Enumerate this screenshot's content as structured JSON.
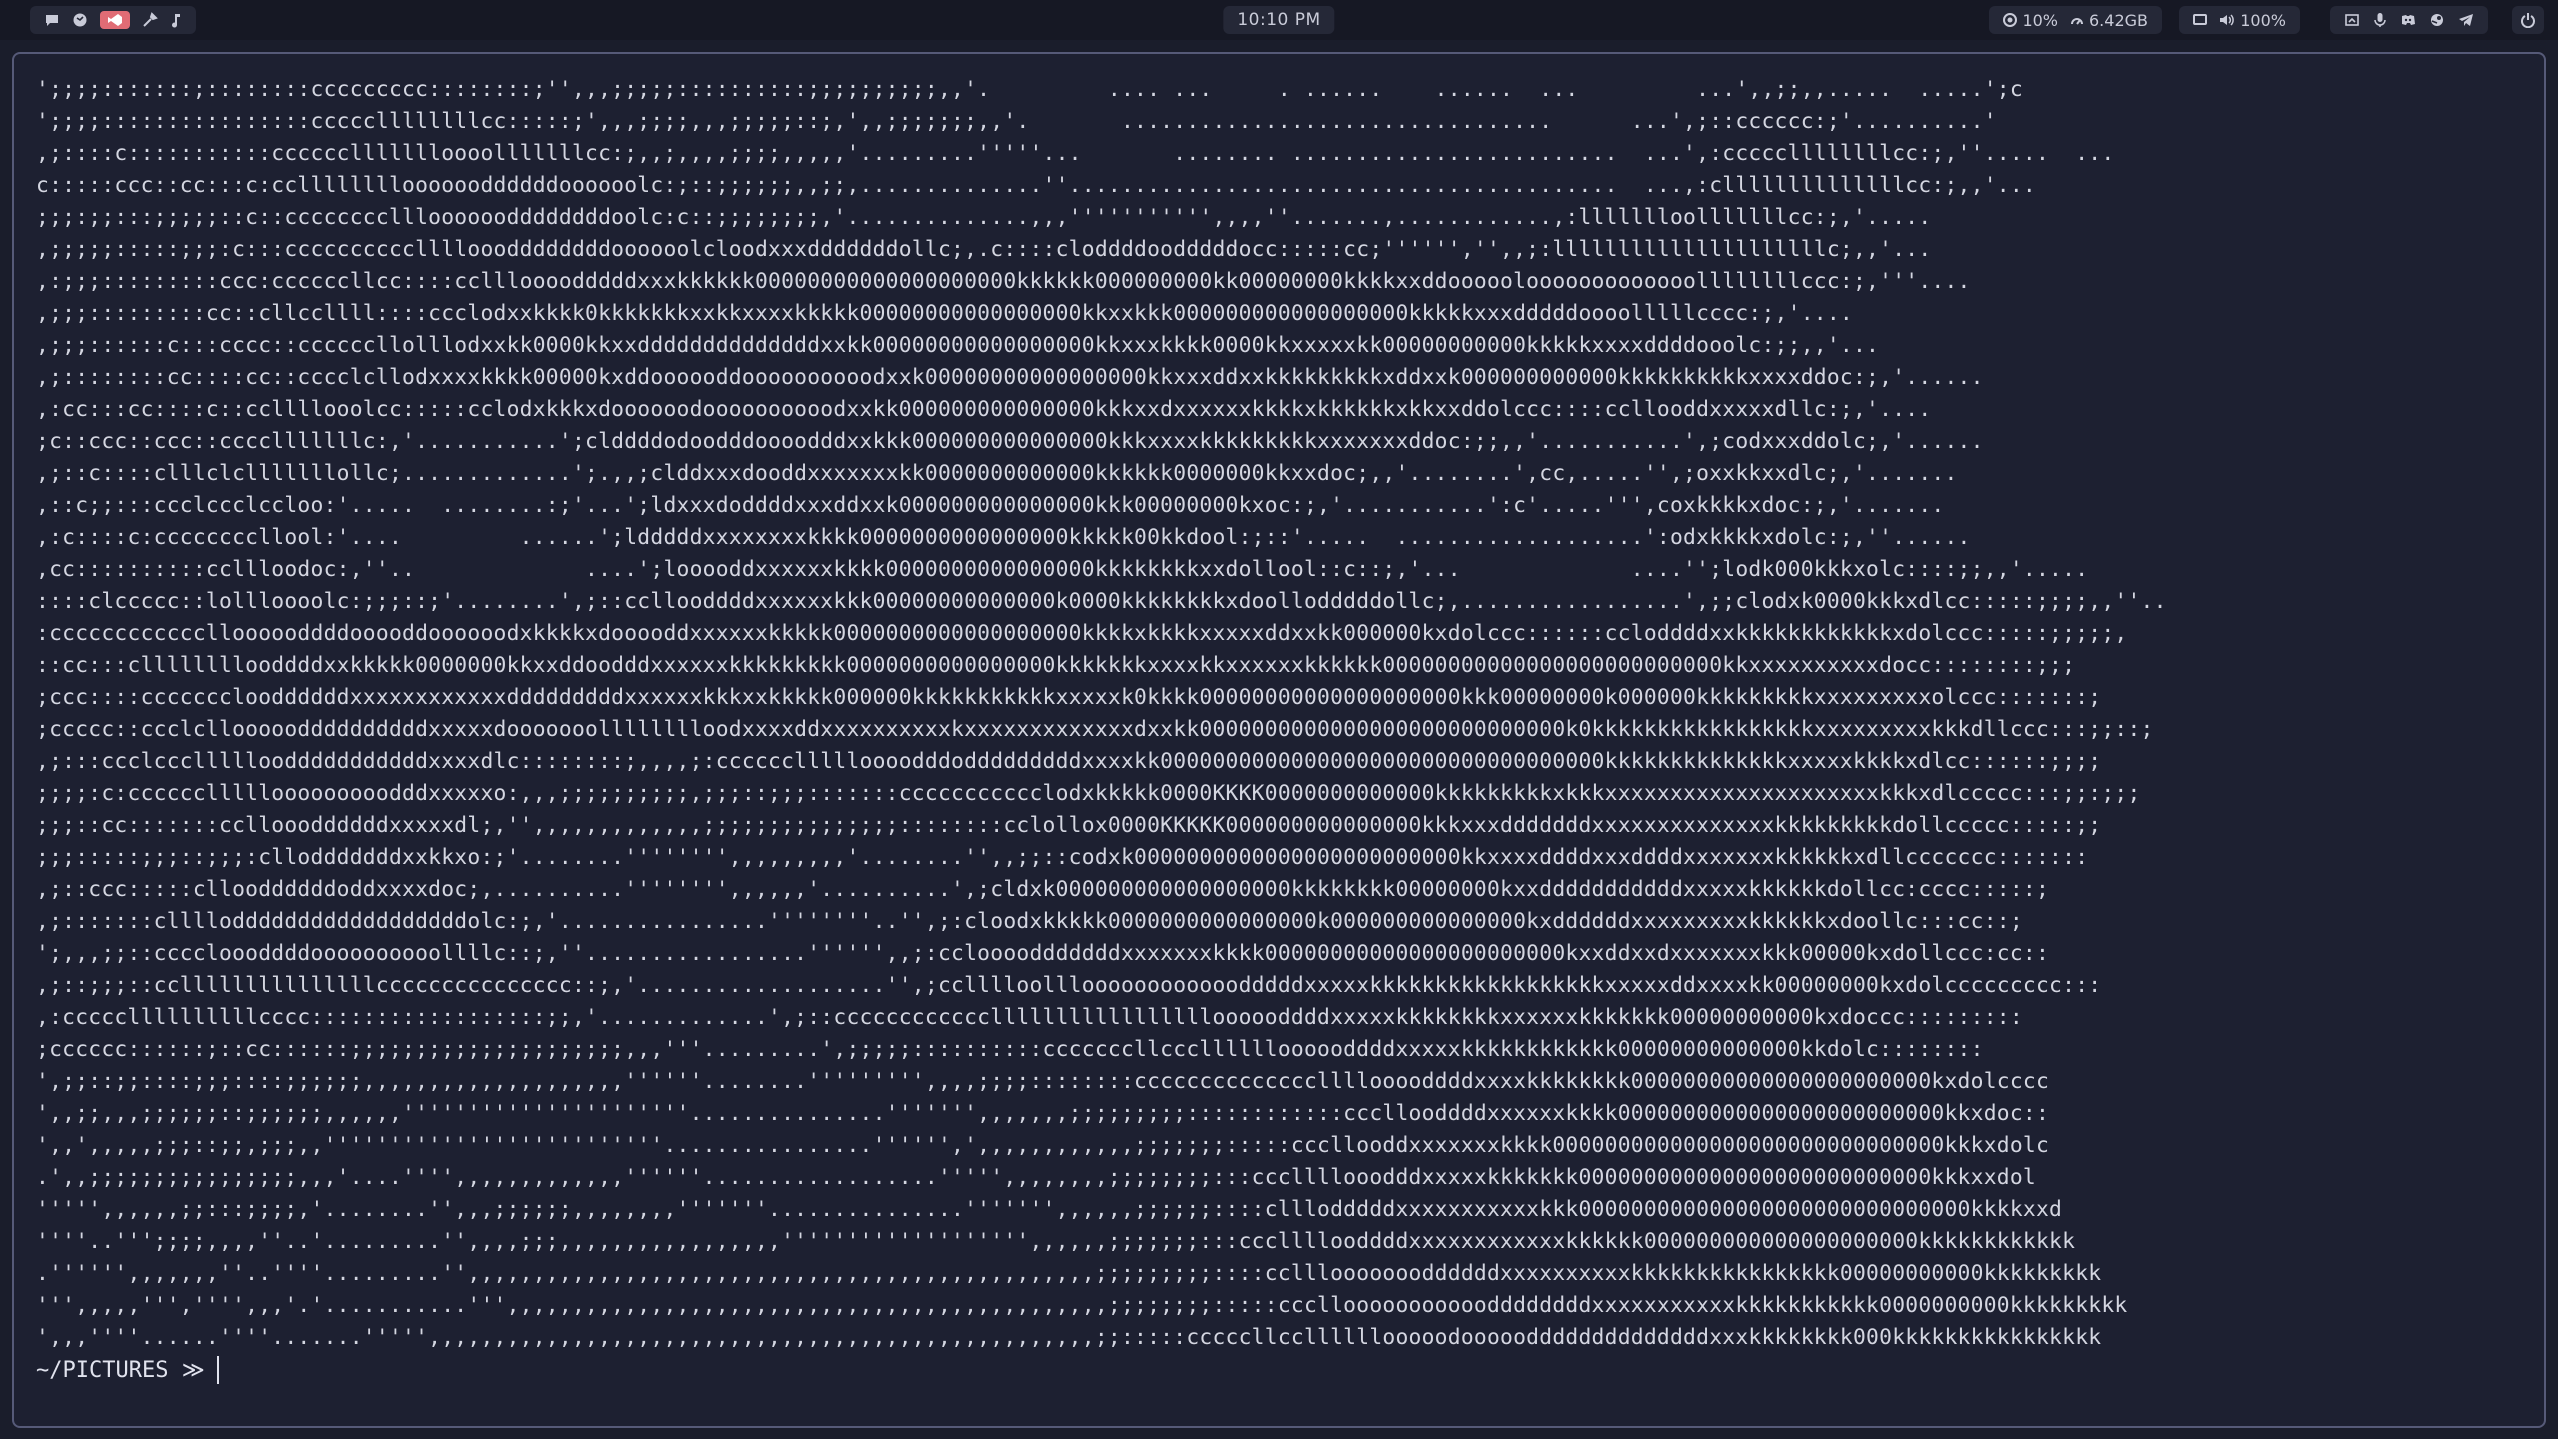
{
  "topbar": {
    "workspaces": [
      {
        "icon": "chat-bubble-icon"
      },
      {
        "icon": "browser-globe-icon"
      },
      {
        "icon": "code-editor-icon",
        "active": true
      },
      {
        "icon": "tools-icon"
      },
      {
        "icon": "music-note-icon"
      }
    ],
    "clock": "10:10 PM",
    "cpu": "10%",
    "memory": "6.42GB",
    "volume": "100%",
    "tray_icons": [
      "screenshot-icon",
      "microphone-icon",
      "discord-icon",
      "steam-icon",
      "telegram-icon"
    ],
    "colors": {
      "bar_bg": "#161824",
      "chip_bg": "#252837",
      "active": "#e06c75"
    }
  },
  "terminal": {
    "lines": [
      "';;;;:::::::;::::::::ccccccccc::::::::;'',,,;;;;;::::::::::;;;;;;;;;;,,'.         .... ...     . ......    ......  ...         ...',,;;,,.....  .....';c",
      "';;;;::::::::::::::::cccccllllllllcc:::::;',,,;;;;,,,;;;;;::;,',,;;;;;;;,,'.       .................................      ...',;::cccccc:;'..........'",
      ",;::::c:::::::::::ccccccllllllloooolllllllcc:;,,;,,,,;;;;,,,,,'.........'''''...       ........ .........................  ...',:cccccllllllllcc:;,''.....  ...",
      "c:::::ccc::cc:::c:ccllllllllooooooddddddoooooolc:;::;;;;;;,,;;,..............''..........................................  ...,:cllllllllllllllcc:;,,'...",
      ";;;:;;:::;;;;;::c::cccccccclllooooooddddddddoolc:c::;;;;;;;;,'..............,,,''''''''''',,,,''.......,............,:llllllloolllllllcc:;,'.....",
      ",;;;;;:::::;;;:c:::cccccccccclllloooddddddddoooooolcloodxxxdddddddollc;,.c::::cloddddoodddddocc:::::cc;'''''','',,;:lllllllllllllllllllllc;,,'...",
      ",:;;;:::::::::ccc:ccccccllcc::::ccllloooodddddxxxkkkkkk00000000000000000000kkkkkk000000000kk00000000kkkkxxddooooolooooooooooooollllllllccc:;,'''....",
      ",;;;:::::::::cc::cllccllll::::ccclodxxkkkk0kkkkkkkxxkkxxxxkkkkk00000000000000000kkxxkkk000000000000000000kkkkkxxxdddddoooolllllcccc:;,'....",
      ",;;;::::::c:::cccc::ccccccllolllodxxkk0000kkxxddddddddddddddxxkk00000000000000000kkxxxkkkk0000kkxxxxxkk00000000000kkkkkxxxxddddooolc:;;,,'...",
      ",;::::::::cc::::cc::cccclcllodxxxxkkkk00000kxddoooooddoooooooooodxxk00000000000000000kkxxxddxxkkkkkkkkkxddxxk000000000000kkkkkkkkkkxxxxddoc:;,'......",
      ",:cc:::cc::::c::ccllllooolcc:::::cclodxkkkxdoooooodoooooooooodxxkk000000000000000kkkxxdxxxxxxkkkkxkkkkkkxkkxxddolccc::::ccllooddxxxxxdllc:;,'....",
      ";c::ccc::ccc::cccclllllllc:,'...........';clddddodoodddoooodddxxkkk000000000000000kkkxxxxkkkkkkkkkxxxxxxxddoc:;;,,'...........',;codxxxddolc;,'......",
      ",;::c::::clllclclllllllollc;.............';.,,;clddxxxdooddxxxxxxxkk0000000000000kkkkkk0000000kkxxdoc;,,'........',cc,.....'',;oxxkkxxdlc;,'.......",
      ",::c;;:::ccclccclccloo:'.....  ........:;'...';ldxxxdoddddxxxddxxk000000000000000kkk00000000kxoc:;,'...........':c'.....''',coxkkkkxdoc:;,'.......",
      ",:c::::c:ccccccccllool:'....         ......';ldddddxxxxxxxxkkkk0000000000000000kkkkk00kkdool:;::'.....  ...................':odxkkkkxdolc:;,''......",
      ",cc::::::::::ccllloodoc:,''..             ....';looooddxxxxxxkkkk0000000000000000kkkkkkkkxxdollool::c::;,'...             ....'';lodk000kkkxolc::::;;,,'.....",
      "::::clccccc::lollloooolc:;;;::;'........',;::ccllooddddxxxxxxkkk00000000000000k0000kkkkkkkkxdoollodddddollc;,.................',;;clodxk0000kkkxdlcc:::::;;;;,,''..",
      ":cccccccccccclloooooddddooooddoooooodxkkkkxdooooddxxxxxxkkkkk0000000000000000000kkkkxkkkkxxxxxddxxkk000000kxdolccc::::::ccloddddxxkkkkkkkkkkkkxdolccc:::::;;;;;,",
      "::cc:::cllllllllooddddxxkkkkk0000000kkxxddoodddxxxxxxkkkkkkkkk0000000000000000kkkkkkkxxxxkkxxxxxxkkkkkk00000000000000000000000000kkxxxxxxxxxxdocc::::::::;;;",
      ";ccc::::ccccccclooddddddxxxxxxxxxxxxdddddddddxxxxxxkkkxxkkkkk000000kkkkkkkkkkkxxxxxk0kkkk00000000000000000000kkk00000000k000000kkkkkkkkkxxxxxxxxxolccc:::::::;",
      ";ccccc::ccclclloooooddddddddddxxxxxdooooooolllllllloodxxxxddxxxxxxxxxxkxxxxxxxxxxxxxdxxkk0000000000000000000000000000k0kkkkkkkkkkkkkkkkkxxxxxxxxxkkkdllccc:::;;::;",
      ",;:::ccclcccllllloodddddddddddxxxxdlc::::::::;,,,,;:ccccccllllloooodddodddddddddxxxxkk0000000000000000000000000000000000kkkkkkkkkkkkkkxxxxxkkkkxdlcc::::::;;;;",
      ";;;;:c:cccccclllllooooooooodddxxxxxo:,,,;;;;;;;;;;,;;;::;;;:::::::ccccccccccclodxkkkkk0000KKKK0000000000000kkkkkkkkkxkkkxxxxxxxxxxxxxxxxxxxxxkkkxdlccccc:::;;:;;;",
      ";;;::cc:::::::cclloooddddddxxxxxdl;,'',,,,,,,,,,,,,;;;;;;;;;;;;;;;::::::::cclollox0000KKKKK000000000000000kkkxxxdddddddxxxxxxxxxxxxxxkkkkkkkkkdollccccc:::::;;",
      ";;;:::::;;;::;;;:cllodddddddxxkkxo:;'........'''''''',,,,,,,,,'........'',,;;::codxk0000000000000000000000000kkxxxxddddxxxddddxxxxxxxkkkkkkxdllccccccc:::::::",
      ",;::ccc:::::cllooddddddoddxxxxdoc;,..........'''''''',,,,,,'..........',;cldxk000000000000000000kkkkkkkk00000000kxxdddddddddddxxxxxkkkkkkdollcc:cccc:::::;",
      ",;:::::::clllloddddddddddddddddddolc:;,'................''''''''..'',;:cloodxkkkkk0000000000000000k000000000000000kxddddddxxxxxxxxxkkkkkkxdoollc:::cc::;",
      "';,,,;;::ccccloooddddoooooooooollllc::;,''.................'''''',,;:ccloooodddddddxxxxxxxkkkk00000000000000000000000kxxddxxdxxxxxxxkkk00000kxdollccc:cc::",
      ",;::;;;::cclllllllllllllllccccccccccccccc::;,'...................'',;cclllloollloooooooooooodddddxxxxxkkkkkkkkkkkkkkkkkkxxxxxddxxxxkk00000000kxdolccccccccc:::",
      ",:cccccllllllllllcccc::::::::::::::::::;;,'.............',;::ccccccccccccllllllllllllllllloooooddddxxxxxkkkkkkkkxxxxxxkkkkkkk00000000000kxdoccc:::::::::",
      ";cccccc::::::;::cc::::::;;;;;;;;;;;;;;;;;;;;;,,,'''.........',;;;;;::::::::::cccccccllccclllllloooooddddxxxxxkkkkkkkkkkkk00000000000000kkdolc::::::::",
      "',;;::;;::::;;;::::;;;;;;,,,,,,,,,,,,,,,,,,,,''''''........''''''''',,,,;;;;::::::::ccccccccccccccllllooooddddxxxxkkkkkkkk00000000000000000000000kxdolcccc",
      "',,;;,,,;;;;;;::;;;;;;,,,,,,''''''''''''''''''''''...............''''''',,,,,,,;;;;;;;;;::::::::::::cccllooddddxxxxxxkkkk0000000000000000000000000kkxdoc::",
      "',,',,,,,;;;::;;,;;;,,''''''''''''''''''''''''''................'''''',',,,,,,,,,,,,;;;;;;;:::::cccllooddxxxxxxxkkkk000000000000000000000000000000kkkxdolc",
      ".',,;;;;;;;;;;;;;;;;,,,'....'''',,,,,,,,,,,,,''''''..................''''',,,,,,,,;;;;;;;;:::cccllllooodddxxxxxkkkkkkk000000000000000000000000000kkkxxdol",
      "''''',,,,,,;;:::;;;;,'........'',,,;;;;;;,,,,,,,,'''''''...............''''''',,,,,,;;;;;;::::clllodddddxxxxxxxxxxxkkk000000000000000000000000000000kkkkxxd",
      "''''..''';;;;,,,,''..'.........'',,,,;;;,,,,,,,,,,,,,,,,,''''''''''''''''''',,,,,,;;;;;;;:::cccllllooddddxxxxxxxxxxxxkkkkkk000000000000000000000kkkkkkkkkkkk",
      ".'''''',,,,,,,''..''''.........'',,,,,,,,,,,,,,,,,,,,,,,,,,,,,,,,,,,,,,,,,,,,,,,,;;;;;;;;;::::ccllloooooooddddddxxxxxxxxxxkkkkkkkkkkkkkkkk00000000000kkkkkkkkk",
      "''',,,,,''','''',,,'.'...........''',,,,,,,,,,,,,,,,,,,,,,,,,,,,,,,,,,,,,,,,,,,,,,;;;;;;;;:::::ccclloooooooooooddddddddxxxxxxxxxxxkkkkkkkkkkk0000000000kkkkkkkkk",
      "',,,''''......''''.......''''',,,,,,,,,,,,,,,,,,,,,,,,,,,,,,,,,,,,,,,,,,,,,,,,,,,;;:::::cccccllccllllllooooodoooooddddddddddddddxxxkkkkkkkk000kkkkkkkkkkkkkkkk"
    ],
    "prompt": "~/PICTURES ≫"
  }
}
